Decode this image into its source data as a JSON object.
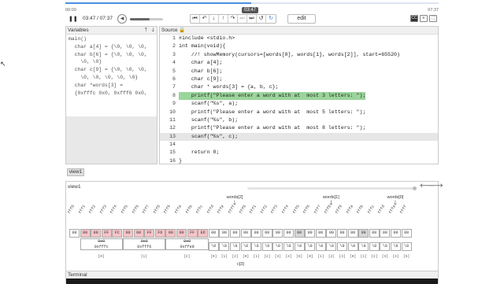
{
  "player": {
    "time_start": "00:00",
    "time_end": "07:37",
    "time_tip": "03:47",
    "time_label": "03:47 / 07:37",
    "progress": 0.497,
    "volume": 0.6,
    "play_glyph": "❚❚",
    "edit_label": "edit",
    "controls": [
      {
        "name": "first-step-icon",
        "glyph": "⏮",
        "state": "normal"
      },
      {
        "name": "step-over-back-icon",
        "glyph": "↶",
        "state": "normal"
      },
      {
        "name": "step-in-back-icon",
        "glyph": "↓",
        "state": "normal"
      },
      {
        "name": "step-out-icon",
        "glyph": "↑",
        "state": "normal"
      },
      {
        "name": "step-over-icon",
        "glyph": "↷",
        "state": "normal"
      },
      {
        "name": "step-in-icon",
        "glyph": "⏭",
        "state": "disabled"
      },
      {
        "name": "last-step-icon",
        "glyph": "⏭",
        "state": "normal"
      },
      {
        "name": "undo-icon",
        "glyph": "↺",
        "state": "normal"
      },
      {
        "name": "redo-icon",
        "glyph": "↻",
        "state": "blue"
      }
    ]
  },
  "variables": {
    "title": "Variables",
    "lines": [
      "main()",
      "  char a[4] = {\\0, \\0, \\0,",
      "  char b[6] = {\\0, \\0, \\0,",
      "    \\0, \\0}",
      "  char c[9] = {\\0, \\0, \\0,",
      "    \\0, \\0, \\0, \\0, \\0}",
      "  char *words[3] =",
      "  {0xfffc 0x0, 0xfff6 0x0,"
    ]
  },
  "source": {
    "title": "Source",
    "lines": [
      {
        "n": "1",
        "code": "#include <stdio.h>"
      },
      {
        "n": "2",
        "code": "int main(void){"
      },
      {
        "n": "3",
        "code": "    //! showMemory(cursors=[words[0], words[1], words[2]], start=65520)"
      },
      {
        "n": "4",
        "code": "    char a[4];"
      },
      {
        "n": "5",
        "code": "    char b[6];"
      },
      {
        "n": "6",
        "code": "    char c[9];"
      },
      {
        "n": "7",
        "code": "    char * words[3] = {a, b, c};"
      },
      {
        "n": "8",
        "code": "    printf(\"Please enter a word with at  most 3 letters: \");"
      },
      {
        "n": "9",
        "code": "    scanf(\"%s\", a);"
      },
      {
        "n": "10",
        "code": "    printf(\"Please enter a word with at  most 5 letters: \");"
      },
      {
        "n": "11",
        "code": "    scanf(\"%s\", b);"
      },
      {
        "n": "12",
        "code": "    printf(\"Please enter a word with at  most 8 letters: \");"
      },
      {
        "n": "13",
        "code": "    scanf(\"%s\", c);"
      },
      {
        "n": "14",
        "code": ""
      },
      {
        "n": "15",
        "code": "    return 0;"
      },
      {
        "n": "16",
        "code": "}"
      }
    ],
    "green_line": "8",
    "grey_line": "13"
  },
  "view_tab": "view1",
  "memory": {
    "title": "view1",
    "cursors": [
      "words[2]",
      "words[1]",
      "words[0]"
    ],
    "addresses": [
      "fff0",
      "fff1",
      "fff2",
      "fff3",
      "fff4",
      "fff5",
      "fff6",
      "fff7",
      "fff8",
      "fff9",
      "fffa",
      "fffb",
      "fffc",
      "fffd",
      "fffe",
      "ffff",
      "fff0",
      "fff1",
      "fff2",
      "fff3",
      "fff4",
      "fff5",
      "fff6",
      "fff7",
      "fff8",
      "fff9",
      "fffa",
      "fffb",
      "fffc",
      "fffd",
      "fffe",
      "ffff"
    ],
    "row_bytes": [
      "00",
      "00",
      "00",
      "FF",
      "FC",
      "00",
      "00",
      "FF",
      "F6",
      "00",
      "00",
      "FF",
      "ED",
      "00",
      "00",
      "00",
      "00",
      "00",
      "00",
      "00",
      "00",
      "00",
      "00",
      "00",
      "00",
      "00",
      "00",
      "00",
      "00",
      "00",
      "00",
      "00"
    ],
    "pointer_groups": [
      {
        "old": "0x0",
        "new": "0xfffc"
      },
      {
        "old": "0x0",
        "new": "0xfff6"
      },
      {
        "old": "0x0",
        "new": "0xffed"
      }
    ],
    "char_row": [
      "\\0",
      "\\0",
      "\\0",
      "\\0",
      "\\0",
      "\\0",
      "\\0",
      "\\0",
      "\\0",
      "\\0",
      "\\0",
      "\\0",
      "\\0",
      "\\0",
      "\\0",
      "\\0",
      "\\0",
      "\\0",
      "\\0",
      "\\0"
    ],
    "index_labels": [
      "[0]",
      "[1]",
      "[2]",
      "[0]",
      "[1]",
      "[2]",
      "[3]",
      "[4]",
      "[5]",
      "[0]",
      "[1]",
      "[2]",
      "[3]",
      "[0]",
      "[1]",
      "[2]",
      "[3]",
      "[4]",
      "[5]",
      "[6]"
    ],
    "group_index_labels": [
      "[0]",
      "[1]",
      "[2]"
    ],
    "xlabel": "c[3]"
  },
  "terminal": {
    "title": "Terminal"
  }
}
